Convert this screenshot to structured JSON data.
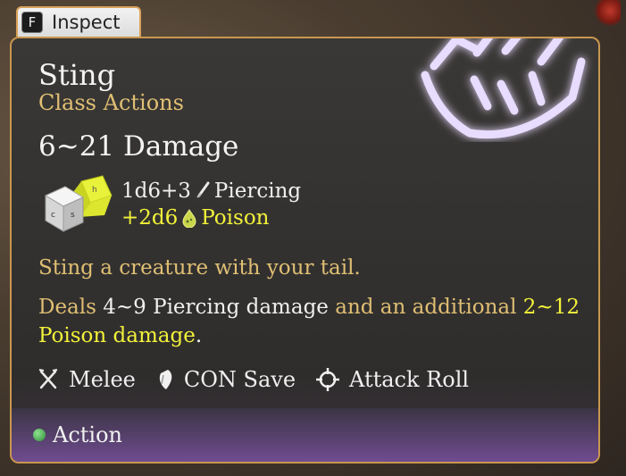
{
  "inspect": {
    "key": "F",
    "label": "Inspect"
  },
  "spell": {
    "name": "Sting",
    "category": "Class Actions",
    "damage_range": "6~21 Damage",
    "rolls": [
      {
        "dice": "1d6+3",
        "type": "Piercing",
        "icon": "piercing-icon",
        "color": "#f0f0f0"
      },
      {
        "dice": "+2d6",
        "type": "Poison",
        "icon": "poison-icon",
        "color": "#f2f23a"
      }
    ],
    "description": "Sting a creature with your tail.",
    "deals": {
      "prefix": "Deals",
      "piercing": "4~9 Piercing damage",
      "middle": "and an additional",
      "poison": "2~12 Poison damage",
      "suffix": "."
    },
    "tags": [
      {
        "label": "Melee",
        "icon": "melee-icon"
      },
      {
        "label": "CON Save",
        "icon": "save-shield-icon"
      },
      {
        "label": "Attack Roll",
        "icon": "crosshair-icon"
      }
    ],
    "cost": {
      "label": "Action",
      "icon": "action-dot-icon",
      "color": "#3fae4a"
    }
  }
}
